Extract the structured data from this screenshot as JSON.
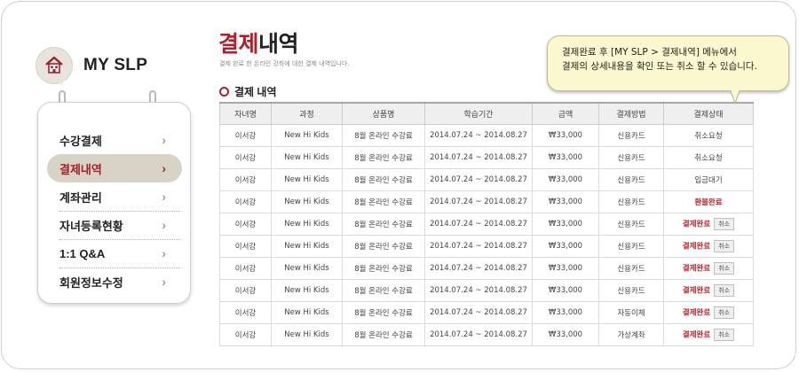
{
  "brand": {
    "title": "MY SLP",
    "icon": "house-icon"
  },
  "menu": {
    "items": [
      {
        "label": "수강결제",
        "active": false
      },
      {
        "label": "결제내역",
        "active": true
      },
      {
        "label": "계좌관리",
        "active": false
      },
      {
        "label": "자녀등록현황",
        "active": false
      },
      {
        "label": "1:1 Q&A",
        "active": false
      },
      {
        "label": "회원정보수정",
        "active": false
      }
    ],
    "chevron": "›"
  },
  "page": {
    "title_red": "결제",
    "title_rest": "내역",
    "subtitle": "결제 완료 한 온라인 강좌에 대한 결제 내역입니다."
  },
  "section": {
    "label": "결제 내역"
  },
  "callout": {
    "line1": "결제완료 후 [MY SLP > 결제내역] 메뉴에서",
    "line2": "결제의 상세내용을 확인  또는 취소 할 수 있습니다."
  },
  "table": {
    "headers": [
      "자녀명",
      "과정",
      "상품명",
      "학습기간",
      "금액",
      "결제방법",
      "결제상태"
    ],
    "rows": [
      {
        "name": "이서강",
        "course": "New Hi Kids",
        "product": "8월 온라인 수강료",
        "period": "2014.07.24 ~ 2014.08.27",
        "amount": "₩33,000",
        "method": "신용카드",
        "status": "취소요청",
        "status_red": false,
        "cancel": ""
      },
      {
        "name": "이서강",
        "course": "New Hi Kids",
        "product": "8월 온라인 수강료",
        "period": "2014.07.24 ~ 2014.08.27",
        "amount": "₩33,000",
        "method": "신용카드",
        "status": "취소요청",
        "status_red": false,
        "cancel": ""
      },
      {
        "name": "이서강",
        "course": "New Hi Kids",
        "product": "8월 온라인 수강료",
        "period": "2014.07.24 ~ 2014.08.27",
        "amount": "₩33,000",
        "method": "신용카드",
        "status": "입금대기",
        "status_red": false,
        "cancel": ""
      },
      {
        "name": "이서강",
        "course": "New Hi Kids",
        "product": "8월 온라인 수강료",
        "period": "2014.07.24 ~ 2014.08.27",
        "amount": "₩33,000",
        "method": "신용카드",
        "status": "환불완료",
        "status_red": true,
        "cancel": ""
      },
      {
        "name": "이서강",
        "course": "New Hi Kids",
        "product": "8월 온라인 수강료",
        "period": "2014.07.24 ~ 2014.08.27",
        "amount": "₩33,000",
        "method": "신용카드",
        "status": "결제완료",
        "status_red": true,
        "cancel": "취소"
      },
      {
        "name": "이서강",
        "course": "New Hi Kids",
        "product": "8월 온라인 수강료",
        "period": "2014.07.24 ~ 2014.08.27",
        "amount": "₩33,000",
        "method": "신용카드",
        "status": "결제완료",
        "status_red": true,
        "cancel": "취소"
      },
      {
        "name": "이서강",
        "course": "New Hi Kids",
        "product": "8월 온라인 수강료",
        "period": "2014.07.24 ~ 2014.08.27",
        "amount": "₩33,000",
        "method": "신용카드",
        "status": "결제완료",
        "status_red": true,
        "cancel": "취소"
      },
      {
        "name": "이서강",
        "course": "New Hi Kids",
        "product": "8월 온라인 수강료",
        "period": "2014.07.24 ~ 2014.08.27",
        "amount": "₩33,000",
        "method": "신용카드",
        "status": "결제완료",
        "status_red": true,
        "cancel": "취소"
      },
      {
        "name": "이서강",
        "course": "New Hi Kids",
        "product": "8월 온라인 수강료",
        "period": "2014.07.24 ~ 2014.08.27",
        "amount": "₩33,000",
        "method": "자동이체",
        "status": "결제완료",
        "status_red": true,
        "cancel": "취소"
      },
      {
        "name": "이서강",
        "course": "New Hi Kids",
        "product": "8월 온라인 수강료",
        "period": "2014.07.24 ~ 2014.08.27",
        "amount": "₩33,000",
        "method": "가상계좌",
        "status": "결제완료",
        "status_red": true,
        "cancel": "취소"
      }
    ]
  },
  "colors": {
    "accent": "#b31f28",
    "active_bg": "#d9d3c7",
    "callout_bg": "#fbf8cf"
  }
}
